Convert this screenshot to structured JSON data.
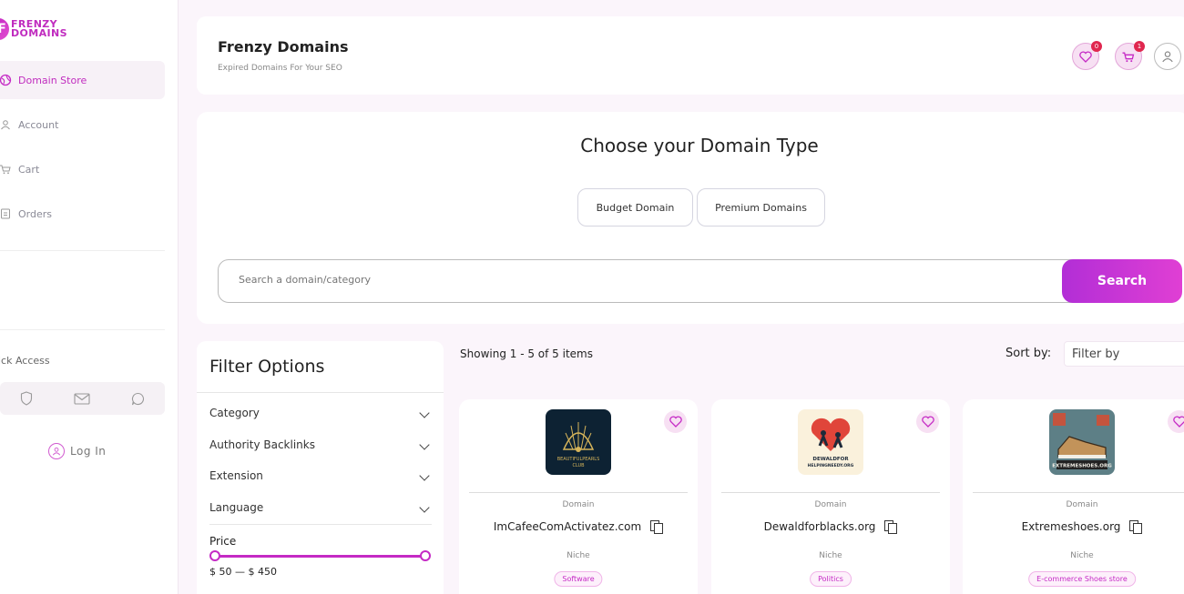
{
  "brand": {
    "mark": "F",
    "line1": "FRENZY",
    "line2": "DOMAINS"
  },
  "sidebar": {
    "items": [
      {
        "label": "Domain Store",
        "icon": "globe-icon",
        "active": true
      },
      {
        "label": "Account",
        "icon": "user-icon",
        "active": false
      },
      {
        "label": "Cart",
        "icon": "cart-icon",
        "active": false
      },
      {
        "label": "Orders",
        "icon": "orders-icon",
        "active": false
      }
    ],
    "quick_access_title": "ick Access",
    "quick_access_icons": [
      "shield-icon",
      "mail-icon",
      "chat-icon"
    ],
    "login_label": "Log In"
  },
  "header": {
    "title": "Frenzy Domains",
    "subtitle": "Expired Domains For Your SEO",
    "wishlist_count": "0",
    "cart_count": "1"
  },
  "domain_type": {
    "title": "Choose your Domain Type",
    "options": [
      "Budget Domain",
      "Premium Domains"
    ],
    "search_placeholder": "Search a domain/category",
    "search_button": "Search"
  },
  "filters": {
    "title": "Filter Options",
    "groups": [
      "Category",
      "Authority Backlinks",
      "Extension",
      "Language"
    ],
    "price_label": "Price",
    "price_range": "$ 50 — $ 450",
    "price_min_fraction": 0,
    "price_max_fraction": 1
  },
  "listing": {
    "showing": "Showing 1 - 5 of 5 items",
    "sort_label": "Sort by:",
    "sort_value": "Filter by"
  },
  "cards": [
    {
      "type_label": "Domain",
      "name": "ImCafeeComActivatez.com",
      "niche_label": "Niche",
      "niche": "Software",
      "logo_text": "BEAUTIFULPEARLS CLUB"
    },
    {
      "type_label": "Domain",
      "name": "Dewaldforblacks.org",
      "niche_label": "Niche",
      "niche": "Politics",
      "logo_text": "DEWALDFOR HELPINGNEEDY.ORG"
    },
    {
      "type_label": "Domain",
      "name": "Extremeshoes.org",
      "niche_label": "Niche",
      "niche": "E-commerce Shoes store",
      "logo_text": "EXTREMESHOES.ORG"
    }
  ],
  "colors": {
    "accent": "#c52ac5",
    "badge": "#e0274f"
  }
}
